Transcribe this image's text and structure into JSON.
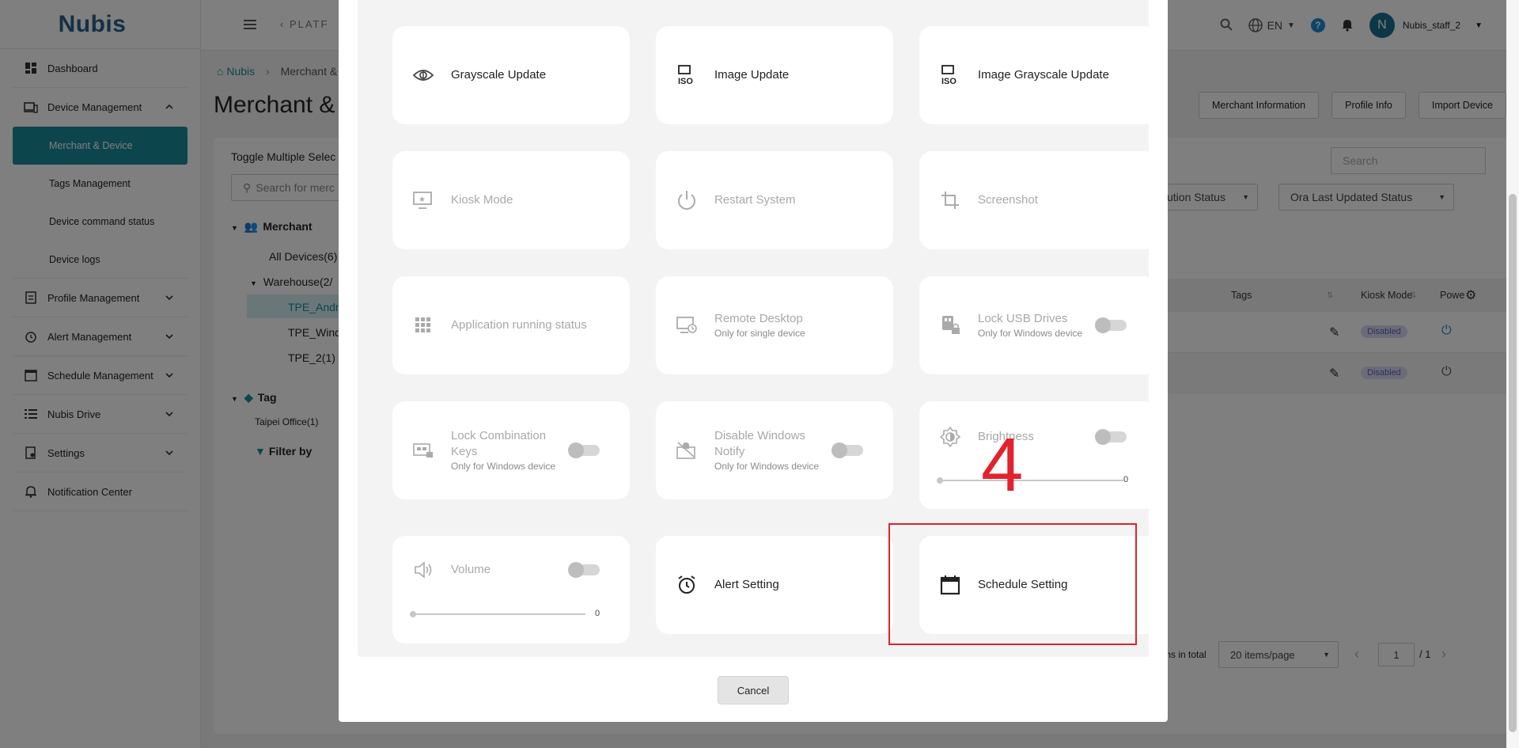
{
  "brand": {
    "logo": "Nubis"
  },
  "sidebar": {
    "items": [
      {
        "label": "Dashboard"
      },
      {
        "label": "Device Management"
      },
      {
        "label": "Profile Management"
      },
      {
        "label": "Alert Management"
      },
      {
        "label": "Schedule Management"
      },
      {
        "label": "Nubis Drive"
      },
      {
        "label": "Settings"
      },
      {
        "label": "Notification Center"
      }
    ],
    "subitems": [
      {
        "label": "Merchant & Device"
      },
      {
        "label": "Tags Management"
      },
      {
        "label": "Device command status"
      },
      {
        "label": "Device logs"
      }
    ]
  },
  "header": {
    "breadcrumb": "PLATF",
    "language": "EN",
    "avatar_letter": "N",
    "username": "Nubis_staff_2"
  },
  "page": {
    "crumb_home": "Nubis",
    "crumb_current": "Merchant &",
    "title": "Merchant &",
    "buttons": [
      "Merchant Information",
      "Profile Info",
      "Import Device"
    ],
    "toggle_label": "Toggle Multiple Selec",
    "search_merchant_placeholder": "Search for merc",
    "search_placeholder": "Search",
    "filter_1": "ution Status",
    "filter_2": "Ora Last Updated Status",
    "tree": {
      "merchant": "Merchant",
      "all_devices": "All Devices(6)",
      "warehouse": "Warehouse(2/",
      "items": [
        "TPE_Andr",
        "TPE_Wind",
        "TPE_2(1)"
      ],
      "tag": "Tag",
      "tag_item": "Taipei Office(1)",
      "filter_by": "Filter by"
    },
    "table": {
      "columns": [
        "Tags",
        "Kiosk Mode",
        "Powe"
      ],
      "rows": [
        {
          "kiosk": "Disabled"
        },
        {
          "kiosk": "Disabled"
        }
      ]
    },
    "pagination": {
      "total_label": "tems in total",
      "page_size": "20 items/page",
      "page": "1",
      "total_pages": "/ 1"
    }
  },
  "modal": {
    "tiles": [
      {
        "label": "Grayscale Update",
        "icon": "grayscale-icon",
        "enabled": true
      },
      {
        "label": "Image Update",
        "icon": "iso-icon",
        "enabled": true
      },
      {
        "label": "Image Grayscale Update",
        "icon": "iso-icon",
        "enabled": true
      },
      {
        "label": "Kiosk Mode",
        "icon": "kiosk-icon",
        "enabled": false
      },
      {
        "label": "Restart System",
        "icon": "power-icon",
        "enabled": false
      },
      {
        "label": "Screenshot",
        "icon": "crop-icon",
        "enabled": false
      },
      {
        "label": "Application running status",
        "icon": "grid-icon",
        "enabled": false
      },
      {
        "label": "Remote Desktop",
        "sub": "Only for single device",
        "icon": "remote-desktop-icon",
        "enabled": false
      },
      {
        "label": "Lock USB Drives",
        "sub": "Only for Windows device",
        "icon": "usb-lock-icon",
        "enabled": false
      },
      {
        "label": "Lock Combination Keys",
        "sub": "Only for Windows device",
        "icon": "keyboard-lock-icon",
        "enabled": false
      },
      {
        "label": "Disable Windows Notify",
        "sub": "Only for Windows device",
        "icon": "notify-off-icon",
        "enabled": false
      },
      {
        "label": "Brightness",
        "value": "0",
        "icon": "brightness-icon",
        "enabled": false
      },
      {
        "label": "Volume",
        "value": "0",
        "icon": "volume-icon",
        "enabled": false
      },
      {
        "label": "Alert Setting",
        "icon": "alarm-clock-icon",
        "enabled": true
      },
      {
        "label": "Schedule Setting",
        "icon": "calendar-icon",
        "enabled": true
      }
    ],
    "cancel_label": "Cancel"
  },
  "annotation": {
    "step_number": "4",
    "color": "#e0232e"
  },
  "colors": {
    "accent": "#1a8b9b",
    "brand": "#2a5f8f"
  }
}
